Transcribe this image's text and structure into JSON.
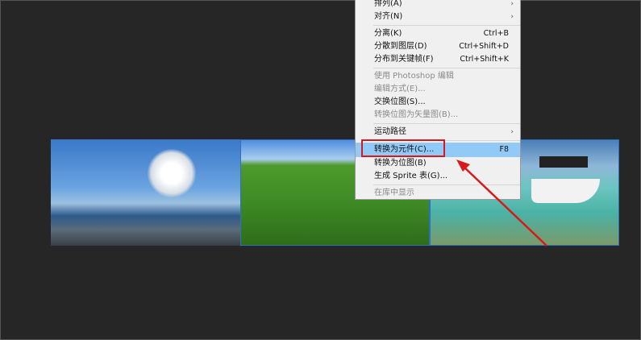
{
  "menu": {
    "items": [
      {
        "label": "排列(A)",
        "shortcut": "",
        "submenu": true,
        "disabled": false
      },
      {
        "label": "对齐(N)",
        "shortcut": "",
        "submenu": true,
        "disabled": false
      },
      {
        "label": "分离(K)",
        "shortcut": "Ctrl+B",
        "disabled": false
      },
      {
        "label": "分散到图层(D)",
        "shortcut": "Ctrl+Shift+D",
        "disabled": false
      },
      {
        "label": "分布到关键帧(F)",
        "shortcut": "Ctrl+Shift+K",
        "disabled": false
      },
      {
        "label": "使用 Photoshop 编辑",
        "shortcut": "",
        "disabled": true
      },
      {
        "label": "编辑方式(E)...",
        "shortcut": "",
        "disabled": true
      },
      {
        "label": "交换位图(S)...",
        "shortcut": "",
        "disabled": false
      },
      {
        "label": "转换位图为矢量图(B)...",
        "shortcut": "",
        "disabled": true
      },
      {
        "label": "运动路径",
        "shortcut": "",
        "submenu": true,
        "disabled": false
      },
      {
        "label": "转换为元件(C)...",
        "shortcut": "F8",
        "highlighted": true,
        "disabled": false
      },
      {
        "label": "转换为位图(B)",
        "shortcut": "",
        "disabled": false
      },
      {
        "label": "生成 Sprite 表(G)...",
        "shortcut": "",
        "disabled": false
      },
      {
        "label": "在库中显示",
        "shortcut": "",
        "disabled": true
      }
    ],
    "submenu_glyph": "›"
  },
  "colors": {
    "highlight": "#91c9f7",
    "annotation": "#d8191b"
  }
}
